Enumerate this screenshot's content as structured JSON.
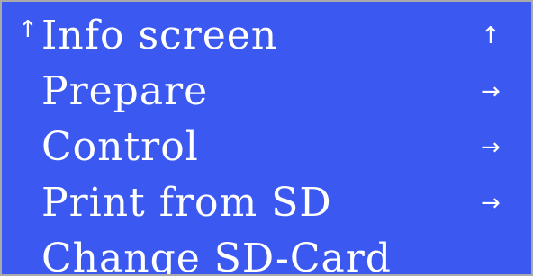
{
  "colors": {
    "background": "#3b59f0",
    "text": "#ffffff",
    "border": "#a9a9a9"
  },
  "menu": {
    "items": [
      {
        "marker": "↑",
        "label": "Info screen",
        "arrow": "↑",
        "icon": "up-arrow-icon",
        "selected": true
      },
      {
        "marker": "",
        "label": "Prepare",
        "arrow": "→",
        "icon": "right-arrow-icon",
        "selected": false
      },
      {
        "marker": "",
        "label": "Control",
        "arrow": "→",
        "icon": "right-arrow-icon",
        "selected": false
      },
      {
        "marker": "",
        "label": "Print from SD",
        "arrow": "→",
        "icon": "right-arrow-icon",
        "selected": false
      },
      {
        "marker": "",
        "label": "Change SD-Card",
        "arrow": "",
        "icon": "",
        "selected": false
      }
    ]
  }
}
